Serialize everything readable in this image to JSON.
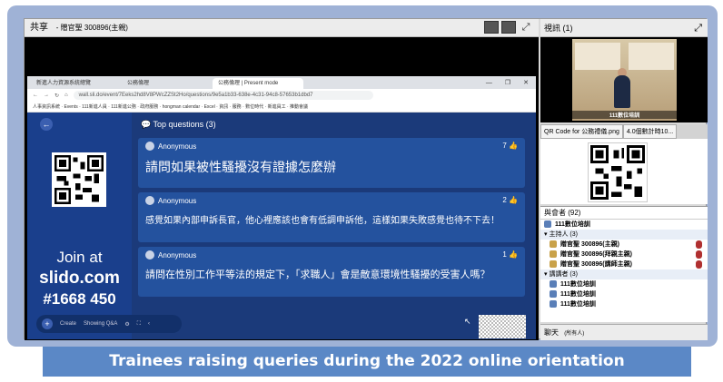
{
  "share": {
    "title": "共享",
    "subtitle": "- 贈官聖 300896(主親)"
  },
  "browser": {
    "tabs": [
      "新進人力資源系統總覽",
      "公務倫理",
      "公務倫理 | Present mode"
    ],
    "url": "wall.sli.do/event/7Eeks2hd8V8PWcZZSt2Ho/questions/9e5a1b33-638e-4c31-94c8-57653b1dbd7",
    "bookmarks": "人事資訊系統 · Events · 111新進人員 · 111新進公務 · 政府服務 · hongman calendar · Excel · 資訊 · 服務 · 數位時代 · 新進員工 · 推動會議"
  },
  "slido": {
    "section_title": "Top questions (3)",
    "join_at": "Join at",
    "site": "slido.com",
    "code": "#1668 450",
    "toolbar_create": "Create",
    "toolbar_showing": "Showing Q&A",
    "questions": [
      {
        "author": "Anonymous",
        "likes": "7",
        "text": "請問如果被性騷擾沒有證據怎麼辦"
      },
      {
        "author": "Anonymous",
        "likes": "2",
        "text": "感覺如果內部申訴長官，他心裡應該也會有低調申訴他，這樣如果失敗感覺也待不下去！"
      },
      {
        "author": "Anonymous",
        "likes": "1",
        "text": "請問在性別工作平等法的規定下，「求職人」會是敵意環境性騷擾的受害人嗎？"
      }
    ]
  },
  "video": {
    "title": "視訊",
    "count": "(1)",
    "label": "111數位培訓"
  },
  "files": {
    "tab1": "QR Code for 公務禮儀.png",
    "tab2": "4.0個數計時10..."
  },
  "attendees": {
    "title": "與會者",
    "count": "(92)",
    "self": "111數位培訓",
    "hosts_group": "主持人 (3)",
    "hosts": [
      "贈官聖 300896(主親)",
      "贈官聖 300896(拜親主親)",
      "贈官聖 300896(講師主親)"
    ],
    "presenters_group": "講講者 (3)",
    "presenters": [
      "111數位培訓",
      "111數位培訓",
      "111數位培訓"
    ]
  },
  "chat": {
    "title": "聊天",
    "scope": "(所有人)"
  },
  "caption": "Trainees raising queries during the 2022 online orientation"
}
